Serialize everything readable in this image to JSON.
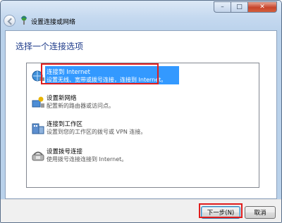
{
  "window": {
    "title": "设置连接或网络",
    "controls": {
      "minimize": "–",
      "maximize": "□",
      "close": "✕"
    }
  },
  "main": {
    "heading": "选择一个连接选项",
    "options": [
      {
        "title": "连接到 Internet",
        "description": "设置无线、宽带或拨号连接，连接到 Internet。",
        "icon": "internet-globe-icon",
        "selected": true
      },
      {
        "title": "设置新网络",
        "description": "配置新的路由器或访问点。",
        "icon": "new-network-icon",
        "selected": false
      },
      {
        "title": "连接到工作区",
        "description": "设置到您的工作区的拨号或 VPN 连接。",
        "icon": "workplace-icon",
        "selected": false
      },
      {
        "title": "设置拨号连接",
        "description": "使用拨号连接连接到 Internet。",
        "icon": "dialup-phone-icon",
        "selected": false
      }
    ]
  },
  "footer": {
    "next_label": "下一步(N)",
    "cancel_label": "取消"
  },
  "colors": {
    "selection": "#3399ff",
    "annotation_red": "#e01d1d",
    "heading_blue": "#1e3b8a"
  }
}
